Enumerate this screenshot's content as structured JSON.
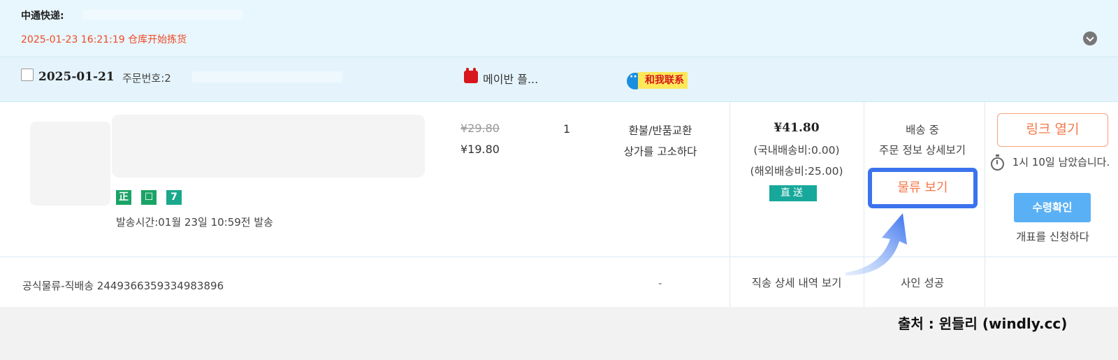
{
  "top": {
    "courier_label": "中通快递:",
    "status_text": "2025-01-23 16:21:19 仓库开始拣货"
  },
  "order": {
    "date": "2025-01-21",
    "order_no_label": "주문번호:2",
    "store_name": "메이반 플...",
    "contact_label": "和我联系"
  },
  "item": {
    "badges": [
      "正",
      "☐",
      "7"
    ],
    "ship_time": "발송시간:01월 23일 10:59전 발송",
    "original_price": "¥29.80",
    "price": "¥19.80",
    "quantity": "1",
    "refund_link": "환불/반품교환",
    "complain_link": "상가를 고소하다"
  },
  "payment": {
    "total": "¥41.80",
    "domestic_fee": "(국내배송비:0.00)",
    "intl_fee": "(해외배송비:25.00)",
    "direct_tag": "直送"
  },
  "status": {
    "shipping": "배송 중",
    "order_detail": "주문 정보 상세보기",
    "logistics_button": "물류 보기"
  },
  "actions": {
    "open_link": "링크 열기",
    "remaining_time": "1시 10일 남았습니다.",
    "confirm_receipt": "수령확인",
    "invoice": "개표를 신청하다"
  },
  "footer_row": {
    "tracking": "공식물류-직배송 2449366359334983896",
    "dash": "-",
    "direct_detail": "직송 상세 내역 보기",
    "sign_status": "사인 성공"
  },
  "source_credit": "출처 : 윈들리 (windly.cc)",
  "colors": {
    "accent_orange": "#f4784a",
    "status_red": "#f04a24",
    "highlight_blue": "#3b73ee",
    "button_blue": "#5ab0f5",
    "direct_green": "#17a89b"
  }
}
